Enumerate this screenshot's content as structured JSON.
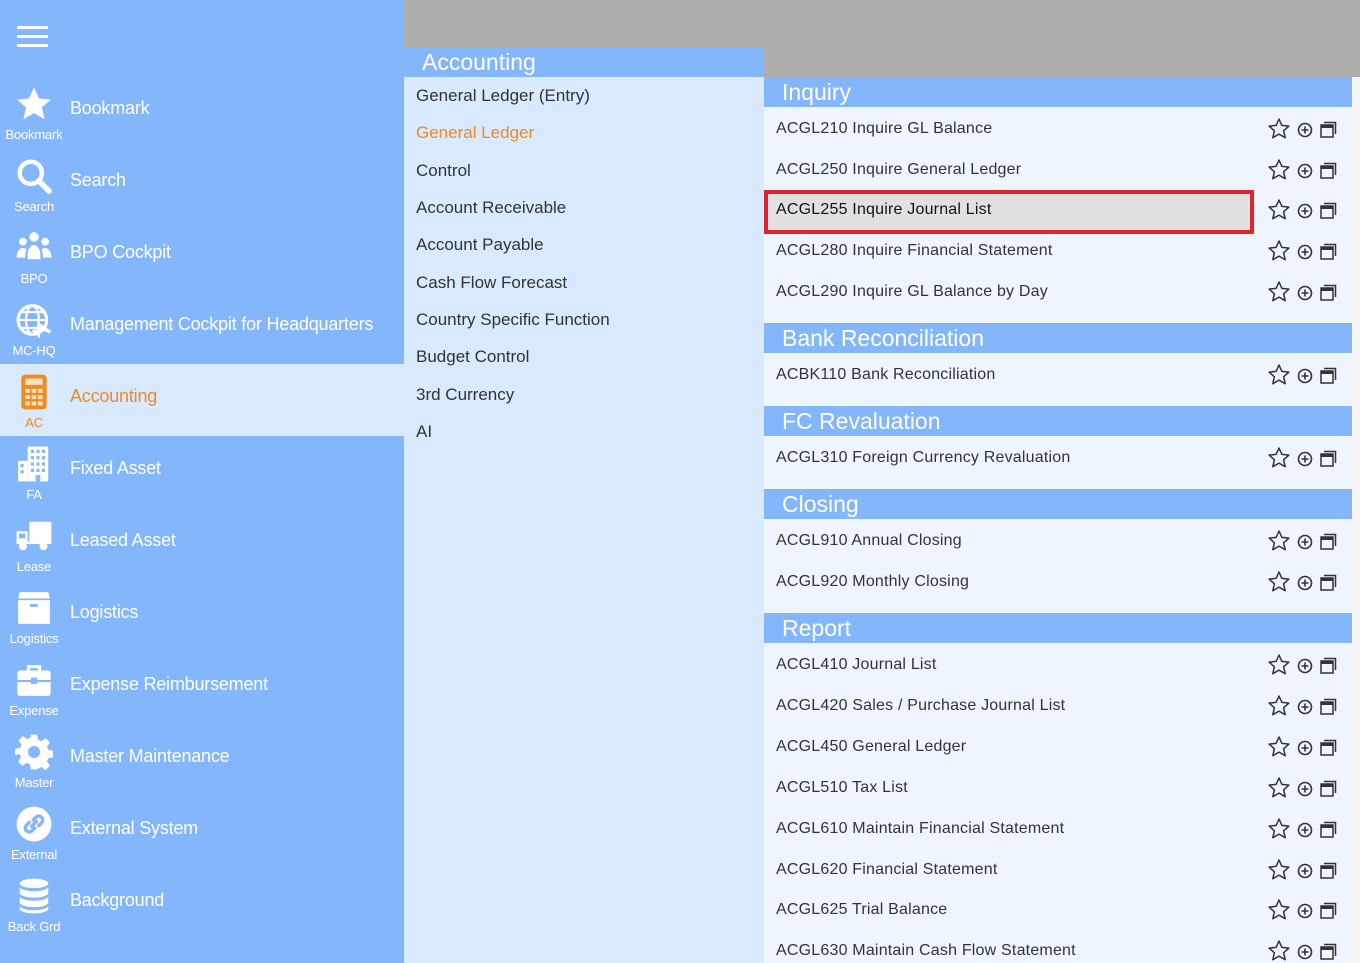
{
  "sidebar": {
    "items": [
      {
        "label": "Bookmark",
        "short": "Bookmark",
        "icon": "star-icon"
      },
      {
        "label": "Search",
        "short": "Search",
        "icon": "search-icon"
      },
      {
        "label": "BPO Cockpit",
        "short": "BPO",
        "icon": "people-icon"
      },
      {
        "label": "Management Cockpit for Headquarters",
        "short": "MC-HQ",
        "icon": "globe-plane-icon"
      },
      {
        "label": "Accounting",
        "short": "AC",
        "icon": "calculator-icon"
      },
      {
        "label": "Fixed Asset",
        "short": "FA",
        "icon": "building-icon"
      },
      {
        "label": "Leased Asset",
        "short": "Lease",
        "icon": "truck-icon"
      },
      {
        "label": "Logistics",
        "short": "Logistics",
        "icon": "box-icon"
      },
      {
        "label": "Expense Reimbursement",
        "short": "Expense",
        "icon": "briefcase-icon"
      },
      {
        "label": "Master Maintenance",
        "short": "Master",
        "icon": "gear-icon"
      },
      {
        "label": "External System",
        "short": "External",
        "icon": "link-icon"
      },
      {
        "label": "Background",
        "short": "Back Grd",
        "icon": "database-icon"
      }
    ],
    "active": "Accounting"
  },
  "categories": {
    "title": "Accounting",
    "items": [
      "General Ledger (Entry)",
      "General Ledger",
      "Control",
      "Account Receivable",
      "Account Payable",
      "Cash Flow Forecast",
      "Country Specific Function",
      "Budget Control",
      "3rd Currency",
      "AI"
    ],
    "active": "General Ledger"
  },
  "sections": {
    "inquiry": {
      "title": "Inquiry",
      "items": [
        "ACGL210 Inquire GL Balance",
        "ACGL250 Inquire General Ledger",
        "ACGL255 Inquire Journal List",
        "ACGL280 Inquire Financial Statement",
        "ACGL290 Inquire GL Balance by Day"
      ]
    },
    "bank": {
      "title": "Bank Reconciliation",
      "items": [
        "ACBK110 Bank Reconciliation"
      ]
    },
    "fc": {
      "title": "FC Revaluation",
      "items": [
        "ACGL310 Foreign Currency Revaluation"
      ]
    },
    "closing": {
      "title": "Closing",
      "items": [
        "ACGL910 Annual Closing",
        "ACGL920 Monthly Closing"
      ]
    },
    "report": {
      "title": "Report",
      "items": [
        "ACGL410 Journal List",
        "ACGL420 Sales / Purchase Journal List",
        "ACGL450 General Ledger",
        "ACGL510 Tax List",
        "ACGL610 Maintain Financial Statement",
        "ACGL620 Financial Statement",
        "ACGL625 Trial Balance",
        "ACGL630 Maintain Cash Flow Statement"
      ]
    }
  },
  "highlighted_item": "ACGL255 Inquire Journal List",
  "colors": {
    "nav_bg": "#84b6fb",
    "panel_bg": "#d9eafe",
    "list_bg": "#eef5ff",
    "active_text": "#ee8a1e",
    "highlight_border": "#e0242b",
    "topbar": "#adadad"
  }
}
